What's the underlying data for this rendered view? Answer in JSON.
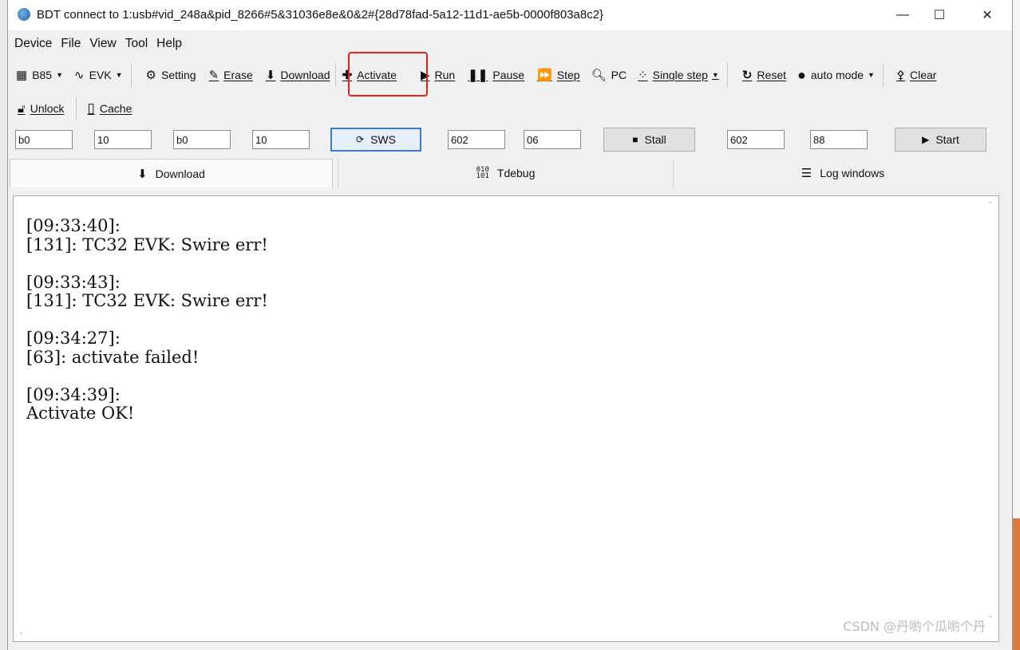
{
  "window": {
    "title": "BDT connect to 1:usb#vid_248a&pid_8266#5&31036e8e&0&2#{28d78fad-5a12-11d1-ae5b-0000f803a8c2}",
    "minimize_glyph": "—",
    "maximize_glyph": "☐",
    "close_glyph": "✕"
  },
  "menu": [
    "Device",
    "File",
    "View",
    "Tool",
    "Help"
  ],
  "toolbar1": {
    "chip_label": "B85",
    "evk_label": "EVK",
    "setting_label": "Setting",
    "erase_label": "Erase",
    "download_label": "Download",
    "activate_label": "Activate",
    "run_label": "Run",
    "pause_label": "Pause",
    "step_label": "Step",
    "pc_label": "PC",
    "single_step_label": "Single step",
    "reset_label": "Reset",
    "auto_mode_label": "auto mode",
    "clear_label": "Clear"
  },
  "toolbar2": {
    "unlock_label": "Unlock",
    "cache_label": "Cache"
  },
  "params": {
    "f1": "b0",
    "f2": "10",
    "f3": "b0",
    "f4": "10",
    "sws_label": "SWS",
    "f5": "602",
    "f6": "06",
    "stall_label": "Stall",
    "f7": "602",
    "f8": "88",
    "start_label": "Start"
  },
  "tabs": {
    "download": "Download",
    "tdebug": "Tdebug",
    "log_windows": "Log windows"
  },
  "log_lines": "[09:33:40]:\n[131]: TC32 EVK: Swire err!\n\n[09:33:43]:\n[131]: TC32 EVK: Swire err!\n\n[09:34:27]:\n[63]: activate failed!\n\n[09:34:39]:\nActivate OK!",
  "watermark": "CSDN @丹喲个瓜喲个丹",
  "colors": {
    "highlight": "#e5211f",
    "focus": "#3b79c9"
  },
  "icons": {
    "app": "app-icon",
    "chip": "chip-icon",
    "evk": "waveform-icon",
    "setting": "gear-icon",
    "erase": "eraser-icon",
    "download": "download-arrow-icon",
    "activate": "plus-icon",
    "run": "run-icon",
    "pause": "pause-icon",
    "step": "step-icon",
    "pc": "search-icon",
    "single_step": "footsteps-icon",
    "reset": "reset-icon",
    "auto_mode": "auto-icon",
    "clear": "broom-icon",
    "unlock": "lock-icon",
    "cache": "sd-card-icon",
    "sws": "refresh-icon",
    "stall": "stop-icon",
    "start": "play-icon",
    "tdebug": "binary-icon",
    "log_windows": "list-icon"
  }
}
